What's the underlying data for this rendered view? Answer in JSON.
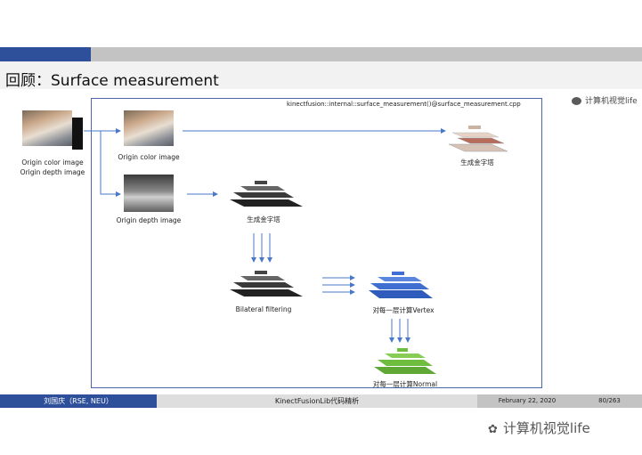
{
  "slide": {
    "title": "回顾：Surface measurement",
    "function_path": "kinectfusion::internal::surface_measurement()@surface_measurement.cpp"
  },
  "inputs": {
    "color_label": "Origin color image",
    "depth_label": "Origin depth image"
  },
  "pipeline": {
    "origin_color_label": "Origin color image",
    "origin_depth_label": "Origin depth image",
    "gray_pyramid_label": "生成金字塔",
    "color_pyramid_label": "生成金字塔",
    "bilateral_label": "Bilateral filtering",
    "vertex_label": "对每一层计算Vertex",
    "normal_label": "对每一层计算Normal"
  },
  "watermark": {
    "top": "计算机视觉life",
    "bottom": "计算机视觉life"
  },
  "footer": {
    "author": "刘国庆（RSE, NEU）",
    "subject": "KinectFusionLib代码精析",
    "date": "February 22, 2020",
    "page": "80/263"
  },
  "colors": {
    "accent_blue": "#2e4f9a",
    "arrow_blue": "#4a78c8",
    "vertex_blue": "#3f6fd1",
    "normal_green": "#6fbd3f"
  }
}
